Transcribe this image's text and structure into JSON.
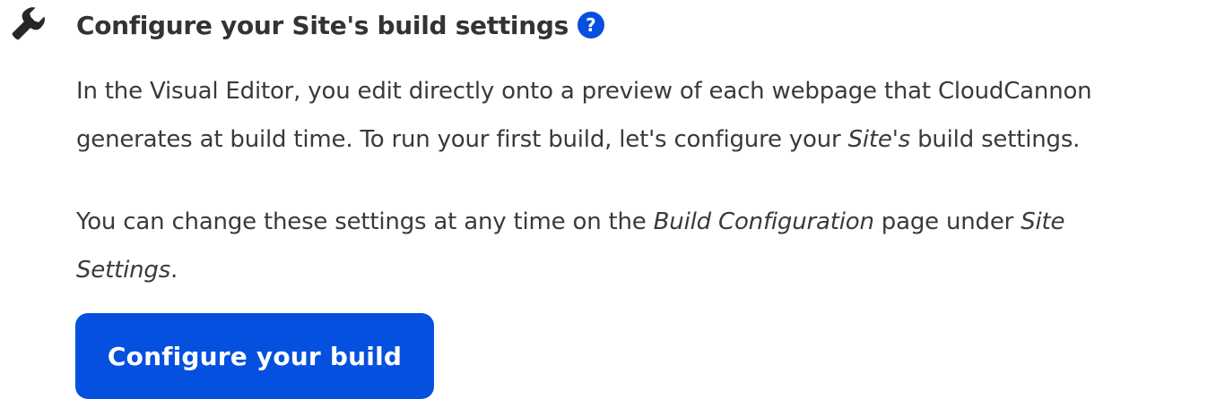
{
  "step": {
    "icon": "wrench-icon",
    "title": "Configure your Site's build settings",
    "help_icon": "question-mark-icon",
    "help_label": "?"
  },
  "description": {
    "p1_line1": "In the Visual Editor, you edit directly onto a preview of each webpage that CloudCannon",
    "p1_line2_before": "generates at build time. To run your first build, let's configure your ",
    "p1_line2_em": "Site's",
    "p1_line2_after": " build settings.",
    "p2_before": "You can change these settings at any time on the ",
    "p2_em1": "Build Configuration",
    "p2_middle": " page under ",
    "p2_em2a": "Site",
    "p2_em2b": "Settings",
    "p2_after": "."
  },
  "actions": {
    "configure_label": "Configure your build"
  },
  "colors": {
    "accent": "#0650e0",
    "text": "#3a3a3a",
    "heading": "#333333"
  }
}
